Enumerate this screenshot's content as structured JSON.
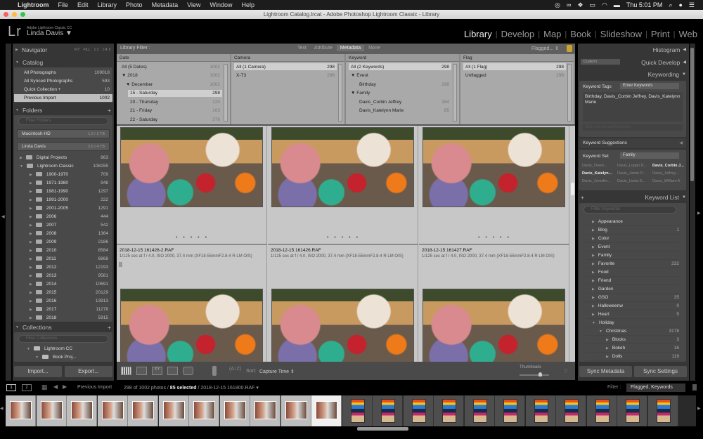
{
  "menubar": {
    "app": "Lightroom",
    "items": [
      "File",
      "Edit",
      "Library",
      "Photo",
      "Metadata",
      "View",
      "Window",
      "Help"
    ],
    "clock": "Thu 5:01 PM"
  },
  "window": {
    "title": "Lightroom Catalog.lrcat - Adobe Photoshop Lightroom Classic - Library"
  },
  "identity": {
    "product": "Adobe Lightroom Classic CC",
    "user": "Linda Davis ▼",
    "logo": "Lr"
  },
  "modules": [
    {
      "label": "Library",
      "active": true
    },
    {
      "label": "Develop"
    },
    {
      "label": "Map"
    },
    {
      "label": "Book"
    },
    {
      "label": "Slideshow"
    },
    {
      "label": "Print"
    },
    {
      "label": "Web"
    }
  ],
  "left": {
    "navigator": {
      "title": "Navigator",
      "zooms": [
        "FIT",
        "FILL",
        "1:1",
        "1:4 ⇕"
      ]
    },
    "catalog": {
      "title": "Catalog",
      "items": [
        {
          "label": "All Photographs",
          "count": "109018"
        },
        {
          "label": "All Synced Photographs",
          "count": "593"
        },
        {
          "label": "Quick Collection +",
          "count": "10"
        },
        {
          "label": "Previous Import",
          "count": "1002",
          "selected": true
        }
      ]
    },
    "folders": {
      "title": "Folders",
      "add": "+",
      "filter_placeholder": "Filter Folders",
      "volumes": [
        {
          "label": "Macintosh HD",
          "size": "1.2 / 2 TB"
        },
        {
          "label": "Linda Davis",
          "size": "2.6 / 4 TB"
        }
      ],
      "items": [
        {
          "label": "Digital Projects",
          "count": "863",
          "level": 0,
          "open": false
        },
        {
          "label": "Lightroom Classic",
          "count": "108155",
          "level": 0,
          "open": true
        },
        {
          "label": "1900-1970",
          "count": "709",
          "level": 1
        },
        {
          "label": "1971-1980",
          "count": "948",
          "level": 1
        },
        {
          "label": "1981-1990",
          "count": "1297",
          "level": 1
        },
        {
          "label": "1991-2000",
          "count": "222",
          "level": 1
        },
        {
          "label": "2001-2005",
          "count": "1291",
          "level": 1
        },
        {
          "label": "2006",
          "count": "444",
          "level": 1
        },
        {
          "label": "2007",
          "count": "542",
          "level": 1
        },
        {
          "label": "2008",
          "count": "1364",
          "level": 1
        },
        {
          "label": "2009",
          "count": "2186",
          "level": 1
        },
        {
          "label": "2010",
          "count": "8584",
          "level": 1
        },
        {
          "label": "2011",
          "count": "6868",
          "level": 1
        },
        {
          "label": "2012",
          "count": "12193",
          "level": 1
        },
        {
          "label": "2013",
          "count": "9581",
          "level": 1
        },
        {
          "label": "2014",
          "count": "10691",
          "level": 1
        },
        {
          "label": "2015",
          "count": "20129",
          "level": 1
        },
        {
          "label": "2016",
          "count": "13913",
          "level": 1
        },
        {
          "label": "2017",
          "count": "11278",
          "level": 1
        },
        {
          "label": "2018",
          "count": "5915",
          "level": 1
        }
      ]
    },
    "collections": {
      "title": "Collections",
      "add": "+",
      "filter_placeholder": "Filter Collections",
      "items": [
        {
          "label": "Lightroom CC",
          "level": 0
        },
        {
          "label": "Book Proj...",
          "level": 1
        }
      ]
    },
    "import": "Import...",
    "export": "Export..."
  },
  "filter": {
    "label": "Library Filter :",
    "tabs": [
      {
        "label": "Text"
      },
      {
        "label": "Attribute"
      },
      {
        "label": "Metadata",
        "active": true
      },
      {
        "label": "None"
      }
    ],
    "preset": "Flagged... ⇕",
    "columns": [
      {
        "header": "Date",
        "rows": [
          {
            "label": "All (5 Dates)",
            "count": "1002",
            "indent": 0
          },
          {
            "label": "▼ 2018",
            "count": "1002",
            "indent": 0
          },
          {
            "label": "▼ December",
            "count": "1002",
            "indent": 1
          },
          {
            "label": "15 - Saturday",
            "count": "298",
            "indent": 2,
            "selected": true
          },
          {
            "label": "20 - Thursday",
            "count": "120",
            "indent": 2
          },
          {
            "label": "21 - Friday",
            "count": "103",
            "indent": 2
          },
          {
            "label": "22 - Saturday",
            "count": "376",
            "indent": 2
          }
        ]
      },
      {
        "header": "Camera",
        "rows": [
          {
            "label": "All (1 Camera)",
            "count": "298",
            "indent": 0,
            "selected": true
          },
          {
            "label": "X-T3",
            "count": "298",
            "indent": 0
          }
        ]
      },
      {
        "header": "Keyword",
        "rows": [
          {
            "label": "All (2 Keywords)",
            "count": "298",
            "indent": 0,
            "selected": true
          },
          {
            "label": "▼ Event",
            "count": "",
            "indent": 0
          },
          {
            "label": "Birthday",
            "count": "298",
            "indent": 2
          },
          {
            "label": "▼ Family",
            "count": "",
            "indent": 0
          },
          {
            "label": "Davis_Corbin Jeffrey",
            "count": "284",
            "indent": 2
          },
          {
            "label": "Davis_Katelynn Marie",
            "count": "85",
            "indent": 2
          }
        ]
      },
      {
        "header": "Flag",
        "rows": [
          {
            "label": "All (1 Flag)",
            "count": "298",
            "indent": 0,
            "selected": true
          },
          {
            "label": "Unflagged",
            "count": "298",
            "indent": 0
          }
        ]
      }
    ]
  },
  "grid": {
    "cells": [
      {
        "file": "2018-12-15 161426-2.RAF",
        "exif": "1/125 sec at f / 4.0, ISO 2000, 37.4 mm (XF18-55mmF2.8-4 R LM OIS)"
      },
      {
        "file": "2018-12-15 161426.RAF",
        "exif": "1/125 sec at f / 4.0, ISO 2000, 37.4 mm (XF18-55mmF2.8-4 R LM OIS)"
      },
      {
        "file": "2018-12-15 161427.RAF",
        "exif": "1/125 sec at f / 4.0, ISO 2000, 37.4 mm (XF18-55mmF2.8-4 R LM OIS)"
      }
    ],
    "rating_dots": "• • • • •"
  },
  "toolbar": {
    "sort_label": "Sort:",
    "sort_value": "Capture Time ⇕",
    "thumbnails_label": "Thumbnails",
    "thumbnail_size": 0.7
  },
  "right": {
    "histogram": "Histogram",
    "quick_develop": "Quick Develop",
    "preset": "Custom",
    "keywording": {
      "title": "Keywording",
      "tags_label": "Keyword Tags",
      "tags_mode": "Enter Keywords",
      "tags_text": "Birthday, Davis_Corbin Jeffrey, Davis_Katelynn Marie",
      "add_placeholder": "Click here to add keywords",
      "suggestions_title": "Keyword Suggestions",
      "set_label": "Keyword Set",
      "set_value": "Family",
      "suggestions": [
        {
          "label": "Davis_Owen...",
          "on": false
        },
        {
          "label": "Davis_Logan D...",
          "on": false
        },
        {
          "label": "Davis_Corbin J...",
          "on": true
        },
        {
          "label": "Davis_Katelyn...",
          "on": true
        },
        {
          "label": "Davis_Jamie P...",
          "on": false
        },
        {
          "label": "Davis_Jeffrey...",
          "on": false
        },
        {
          "label": "Davis_Jennifer...",
          "on": false
        },
        {
          "label": "Davis_Linda K...",
          "on": false
        },
        {
          "label": "Davis_William A",
          "on": false
        }
      ]
    },
    "keyword_list": {
      "title": "Keyword List",
      "add": "+",
      "filter_placeholder": "Filter Keywords",
      "items": [
        {
          "label": "Appearance",
          "count": "",
          "level": 0
        },
        {
          "label": "Blog",
          "count": "1",
          "level": 0
        },
        {
          "label": "Color",
          "count": "",
          "level": 0
        },
        {
          "label": "Event",
          "count": "",
          "level": 0
        },
        {
          "label": "Family",
          "count": "",
          "level": 0
        },
        {
          "label": "Favorite",
          "count": "232",
          "level": 0
        },
        {
          "label": "Food",
          "count": "",
          "level": 0
        },
        {
          "label": "Friend",
          "count": "",
          "level": 0
        },
        {
          "label": "Garden",
          "count": "",
          "level": 0
        },
        {
          "label": "GSO",
          "count": "35",
          "level": 0
        },
        {
          "label": "Halloweenw",
          "count": "0",
          "level": 0
        },
        {
          "label": "Heart",
          "count": "5",
          "level": 0
        },
        {
          "label": "Holiday",
          "count": "",
          "level": 0,
          "open": true
        },
        {
          "label": "Christmas",
          "count": "3178",
          "level": 1,
          "open": true
        },
        {
          "label": "Blocks",
          "count": "3",
          "level": 2
        },
        {
          "label": "Bokeh",
          "count": "16",
          "level": 2
        },
        {
          "label": "Dolls",
          "count": "119",
          "level": 2
        }
      ]
    },
    "sync_metadata": "Sync Metadata",
    "sync_settings": "Sync Settings"
  },
  "bottom": {
    "views": [
      "1",
      "2"
    ],
    "source": "Previous Import",
    "count_text": "298 of 1002 photos /",
    "selected_text": "85 selected",
    "file_text": "/ 2018-12-15 161800.RAF ▾",
    "filter_label": "Filter :",
    "filter_value": "Flagged, Keywords"
  },
  "filmstrip": {
    "left_count": 11,
    "right_count": 11
  }
}
